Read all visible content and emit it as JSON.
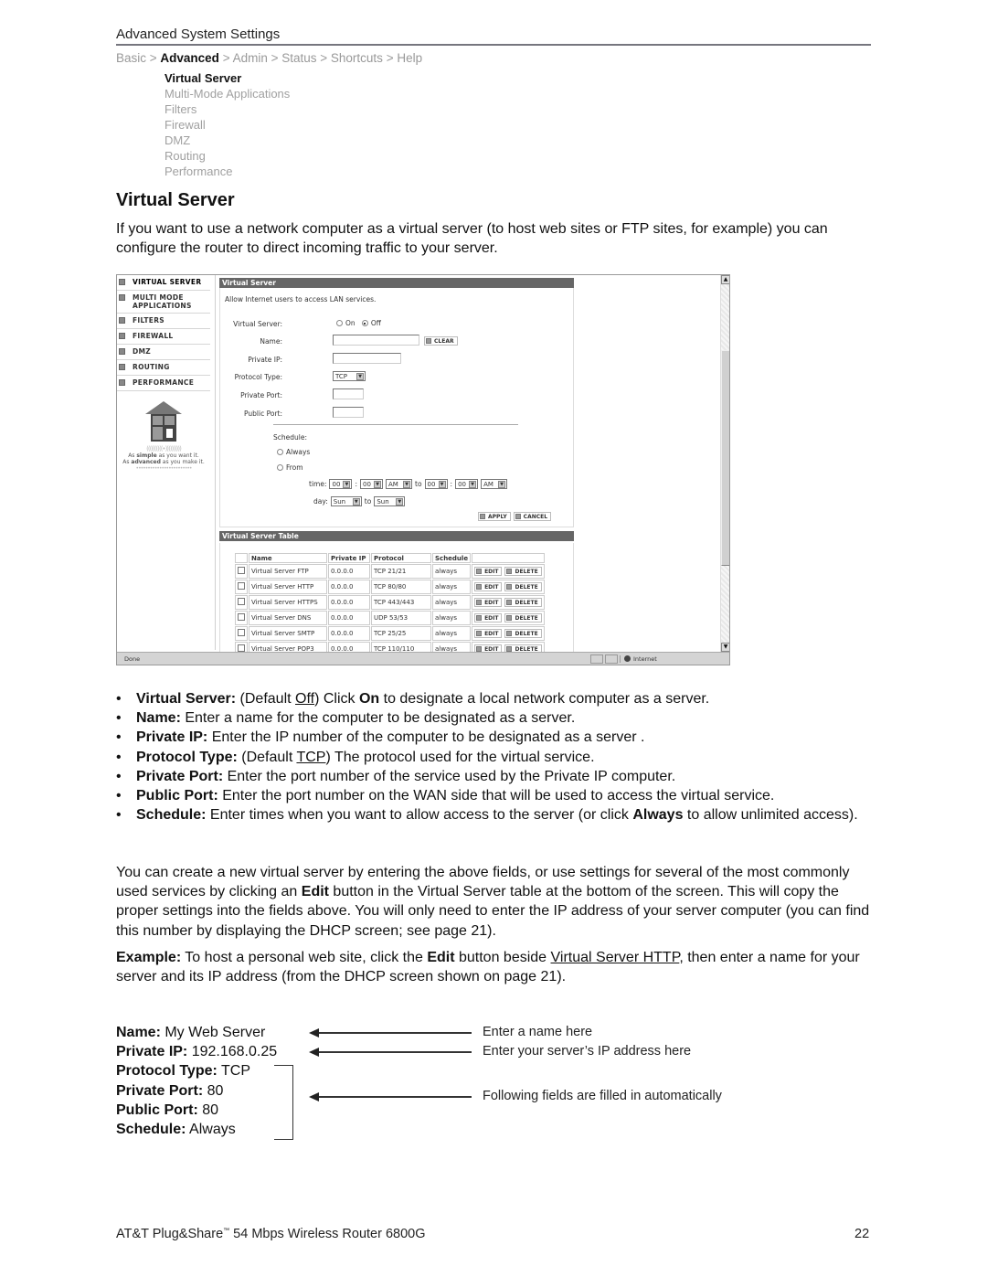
{
  "header": {
    "title": "Advanced System Settings",
    "breadcrumb": [
      {
        "label": "Basic",
        "current": false
      },
      {
        "label": "Advanced",
        "current": true
      },
      {
        "label": "Admin",
        "current": false
      },
      {
        "label": "Status",
        "current": false
      },
      {
        "label": "Shortcuts",
        "current": false
      },
      {
        "label": "Help",
        "current": false
      }
    ],
    "separator": ">",
    "submenu": [
      {
        "label": "Virtual Server",
        "active": true
      },
      {
        "label": "Multi-Mode Applications",
        "active": false
      },
      {
        "label": "Filters",
        "active": false
      },
      {
        "label": "Firewall",
        "active": false
      },
      {
        "label": "DMZ",
        "active": false
      },
      {
        "label": "Routing",
        "active": false
      },
      {
        "label": "Performance",
        "active": false
      }
    ]
  },
  "section": {
    "title": "Virtual Server",
    "intro": "If you want to use a network computer as a virtual server (to host web sites or FTP sites, for example) you can configure the router to direct incoming traffic to your server."
  },
  "screenshot": {
    "nav": [
      "VIRTUAL SERVER",
      "MULTI MODE APPLICATIONS",
      "FILTERS",
      "FIREWALL",
      "DMZ",
      "ROUTING",
      "PERFORMANCE"
    ],
    "logo": {
      "tagline1_pre": "As ",
      "tagline1_bold": "simple",
      "tagline1_post": " as you want it.",
      "tagline2_pre": "As ",
      "tagline2_bold": "advanced",
      "tagline2_post": " as you make it.",
      "waves": "((((((((((•))))))))))",
      "tm": "TM"
    },
    "form": {
      "bar_title": "Virtual Server",
      "description": "Allow Internet users to access LAN services.",
      "virtual_server_label": "Virtual Server:",
      "on_label": "On",
      "off_label": "Off",
      "selected": "Off",
      "name_label": "Name:",
      "name_value": "",
      "clear_label": "CLEAR",
      "private_ip_label": "Private IP:",
      "private_ip_value": "",
      "protocol_label": "Protocol Type:",
      "protocol_value": "TCP",
      "private_port_label": "Private Port:",
      "private_port_value": "",
      "public_port_label": "Public Port:",
      "public_port_value": "",
      "schedule_label": "Schedule:",
      "always_label": "Always",
      "from_label": "From",
      "time_label": "time:",
      "day_label": "day:",
      "to_label": "to",
      "colon": ":",
      "time_from_hour": "00",
      "time_from_min": "00",
      "time_from_ampm": "AM",
      "time_to_hour": "00",
      "time_to_min": "00",
      "time_to_ampm": "AM",
      "day_from": "Sun",
      "day_to": "Sun",
      "apply_label": "APPLY",
      "cancel_label": "CANCEL"
    },
    "table": {
      "bar_title": "Virtual Server Table",
      "columns": [
        "",
        "Name",
        "Private IP",
        "Protocol",
        "Schedule",
        ""
      ],
      "edit_label": "EDIT",
      "delete_label": "DELETE",
      "rows": [
        {
          "name": "Virtual Server FTP",
          "ip": "0.0.0.0",
          "protocol": "TCP 21/21",
          "schedule": "always"
        },
        {
          "name": "Virtual Server HTTP",
          "ip": "0.0.0.0",
          "protocol": "TCP 80/80",
          "schedule": "always"
        },
        {
          "name": "Virtual Server HTTPS",
          "ip": "0.0.0.0",
          "protocol": "TCP 443/443",
          "schedule": "always"
        },
        {
          "name": "Virtual Server DNS",
          "ip": "0.0.0.0",
          "protocol": "UDP 53/53",
          "schedule": "always"
        },
        {
          "name": "Virtual Server SMTP",
          "ip": "0.0.0.0",
          "protocol": "TCP 25/25",
          "schedule": "always"
        },
        {
          "name": "Virtual Server POP3",
          "ip": "0.0.0.0",
          "protocol": "TCP 110/110",
          "schedule": "always"
        }
      ]
    },
    "statusbar": {
      "left": "Done",
      "zone": "Internet"
    }
  },
  "bullets": [
    {
      "parts": [
        {
          "t": "Virtual Server:",
          "s": "b"
        },
        {
          "t": " (Default "
        },
        {
          "t": "Off",
          "s": "u"
        },
        {
          "t": ") Click "
        },
        {
          "t": "On",
          "s": "b"
        },
        {
          "t": " to designate a local network computer as a server."
        }
      ]
    },
    {
      "parts": [
        {
          "t": "Name:",
          "s": "b"
        },
        {
          "t": " Enter a name for the computer to be designated as a server."
        }
      ]
    },
    {
      "parts": [
        {
          "t": "Private IP:",
          "s": "b"
        },
        {
          "t": " Enter the IP number of the computer to be designated as a server ."
        }
      ]
    },
    {
      "parts": [
        {
          "t": "Protocol Type:",
          "s": "b"
        },
        {
          "t": " (Default "
        },
        {
          "t": "TCP",
          "s": "u"
        },
        {
          "t": ") The protocol used for the virtual service."
        }
      ]
    },
    {
      "parts": [
        {
          "t": "Private Port:",
          "s": "b"
        },
        {
          "t": " Enter the port number of the service used by the Private IP computer."
        }
      ]
    },
    {
      "parts": [
        {
          "t": "Public Port:",
          "s": "b"
        },
        {
          "t": " Enter the port number on the WAN side that will be used to access the virtual service."
        }
      ]
    },
    {
      "parts": [
        {
          "t": "Schedule:",
          "s": "b"
        },
        {
          "t": " Enter times when you want to allow access to the server (or click "
        },
        {
          "t": "Always",
          "s": "b"
        },
        {
          "t": " to allow unlimited access)."
        }
      ]
    }
  ],
  "paragraph1": [
    {
      "t": "You can create a new virtual server by entering the above fields, or use settings for several of the most commonly used services by clicking an "
    },
    {
      "t": "Edit",
      "s": "b"
    },
    {
      "t": " button in the Virtual Server table at the bottom of the screen. This will copy the proper settings into the fields above. You will only need to enter the IP address of your server computer (you can find this number by displaying the DHCP screen; see page 21)."
    }
  ],
  "paragraph2": [
    {
      "t": "Example:",
      "s": "b"
    },
    {
      "t": " To host a personal web site, click the "
    },
    {
      "t": "Edit",
      "s": "b"
    },
    {
      "t": " button beside "
    },
    {
      "t": "Virtual Server HTTP",
      "s": "u"
    },
    {
      "t": ", then enter a name for your server and its IP address (from the DHCP screen shown on page 21)."
    }
  ],
  "example": {
    "fields": [
      {
        "label": "Name:",
        "value": " My Web Server"
      },
      {
        "label": "Private IP:",
        "value": " 192.168.0.25"
      },
      {
        "label": "Protocol Type:",
        "value": " TCP"
      },
      {
        "label": "Private Port:",
        "value": " 80"
      },
      {
        "label": "Public Port:",
        "value": " 80"
      },
      {
        "label": "Schedule:",
        "value": " Always"
      }
    ],
    "notes": {
      "name": "Enter a name here",
      "ip": "Enter your server’s IP address here",
      "auto": "Following fields are filled in automatically"
    }
  },
  "footer": {
    "product_pre": "AT&T Plug&Share",
    "tm": "™",
    "product_post": " 54 Mbps Wireless Router 6800G",
    "page": "22"
  }
}
